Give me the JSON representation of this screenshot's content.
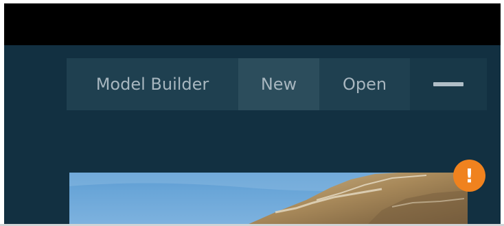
{
  "toolbar": {
    "model_builder_label": "Model Builder",
    "new_label": "New",
    "open_label": "Open",
    "menu_icon": "menu-icon"
  },
  "badge": {
    "text": "!",
    "color": "#f0821e",
    "icon": "alert-icon"
  },
  "colors": {
    "background": "#123041",
    "title_bar": "#000000",
    "toolbar": "#1f4050",
    "toolbar_active": "#2c4d5c",
    "label_text": "#a7b6bf"
  },
  "image": {
    "content": "mountain-landscape"
  }
}
